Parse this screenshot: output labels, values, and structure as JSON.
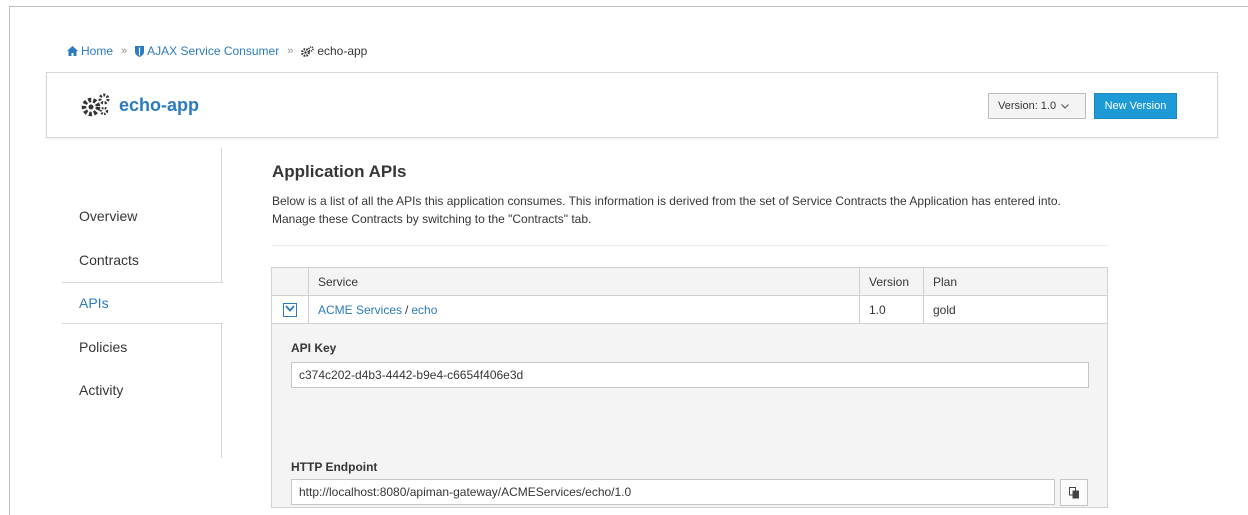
{
  "breadcrumb": {
    "home": "Home",
    "org": "AJAX Service Consumer",
    "current": "echo-app",
    "separator": "»"
  },
  "header": {
    "app_name": "echo-app",
    "version_label": "Version: 1.0",
    "new_version": "New Version"
  },
  "sidebar": {
    "items": [
      {
        "label": "Overview"
      },
      {
        "label": "Contracts"
      },
      {
        "label": "APIs"
      },
      {
        "label": "Policies"
      },
      {
        "label": "Activity"
      }
    ],
    "active": "APIs"
  },
  "main": {
    "title": "Application APIs",
    "description": "Below is a list of all the APIs this application consumes. This information is derived from the set of Service Contracts the Application has entered into. Manage these Contracts by switching to the \"Contracts\" tab."
  },
  "table": {
    "columns": [
      "Service",
      "Version",
      "Plan"
    ],
    "rows": [
      {
        "org": "ACME Services",
        "slash": "/",
        "service": "echo",
        "version": "1.0",
        "plan": "gold"
      }
    ]
  },
  "details": {
    "api_key_label": "API Key",
    "api_key_value": "c374c202-d4b3-4442-b9e4-c6654f406e3d",
    "endpoint_label": "HTTP Endpoint",
    "endpoint_value": "http://localhost:8080/apiman-gateway/ACMEServices/echo/1.0"
  },
  "colors": {
    "link": "#2a7bbf",
    "primary_button": "#1e9ad6"
  },
  "icons": {
    "home": "home-icon",
    "org": "shield-icon",
    "app": "gears-icon",
    "toggle": "chevron-down-icon",
    "copy": "copy-icon"
  }
}
